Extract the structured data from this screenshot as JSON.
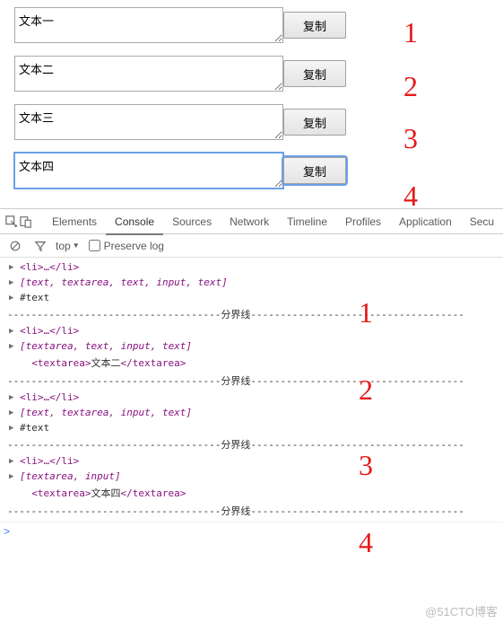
{
  "inputs": [
    {
      "value": "文本一",
      "button": "复制",
      "annot": "1",
      "focused": false
    },
    {
      "value": "文本二",
      "button": "复制",
      "annot": "2",
      "focused": false
    },
    {
      "value": "文本三",
      "button": "复制",
      "annot": "3",
      "focused": false
    },
    {
      "value": "文本四",
      "button": "复制",
      "annot": "4",
      "focused": true
    }
  ],
  "devtools": {
    "tabs": [
      "Elements",
      "Console",
      "Sources",
      "Network",
      "Timeline",
      "Profiles",
      "Application",
      "Secu"
    ],
    "active_tab": "Console",
    "filter": {
      "context": "top",
      "preserve_log_label": "Preserve log"
    }
  },
  "console_groups": [
    {
      "annot": "1",
      "lines": [
        {
          "type": "obj",
          "html": "<li>…</li>"
        },
        {
          "type": "arr",
          "text": "[text, textarea, text, input, text]"
        },
        {
          "type": "obj",
          "text": "#text"
        }
      ]
    },
    {
      "annot": "2",
      "lines": [
        {
          "type": "obj",
          "html": "<li>…</li>"
        },
        {
          "type": "arr",
          "text": "[textarea, text, input, text]"
        },
        {
          "type": "tag",
          "html": "<textarea>文本二</textarea>",
          "indent": true
        }
      ]
    },
    {
      "annot": "3",
      "lines": [
        {
          "type": "obj",
          "html": "<li>…</li>"
        },
        {
          "type": "arr",
          "text": "[text, textarea, input, text]"
        },
        {
          "type": "obj",
          "text": "#text"
        }
      ]
    },
    {
      "annot": "4",
      "lines": [
        {
          "type": "obj",
          "html": "<li>…</li>"
        },
        {
          "type": "arr",
          "text": "[textarea, input]"
        },
        {
          "type": "tag",
          "html": "<textarea>文本四</textarea>",
          "indent": true
        }
      ]
    }
  ],
  "divider_label": "分界线",
  "prompt": ">",
  "watermark": "@51CTO博客"
}
